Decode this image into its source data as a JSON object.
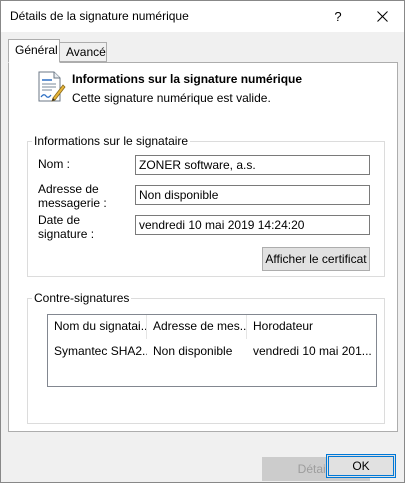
{
  "window": {
    "title": "Détails de la signature numérique",
    "help_glyph": "?"
  },
  "tabs": [
    {
      "label": "Général",
      "active": true
    },
    {
      "label": "Avancé",
      "active": false
    }
  ],
  "header": {
    "title": "Informations sur la signature numérique",
    "subtitle": "Cette signature numérique est valide."
  },
  "signer_group": {
    "legend": "Informations sur le signataire",
    "fields": {
      "name": {
        "label": "Nom :",
        "value": "ZONER software, a.s."
      },
      "email": {
        "label_line1": "Adresse de",
        "label_line2": "messagerie :",
        "value": "Non disponible"
      },
      "date": {
        "label_line1": "Date de",
        "label_line2": "signature :",
        "value": "vendredi 10 mai 2019 14:24:20"
      }
    },
    "cert_button": "Afficher le certificat"
  },
  "countersig_group": {
    "legend": "Contre-signatures",
    "columns": [
      "Nom du signatai...",
      "Adresse de mes...",
      "Horodateur"
    ],
    "rows": [
      [
        "Symantec SHA2...",
        "Non disponible",
        "vendredi 10 mai 201..."
      ]
    ],
    "details_button": "Détails"
  },
  "footer": {
    "ok_label": "OK"
  },
  "colors": {
    "accent": "#0078d7",
    "disabled_text": "#9d9d9d"
  }
}
